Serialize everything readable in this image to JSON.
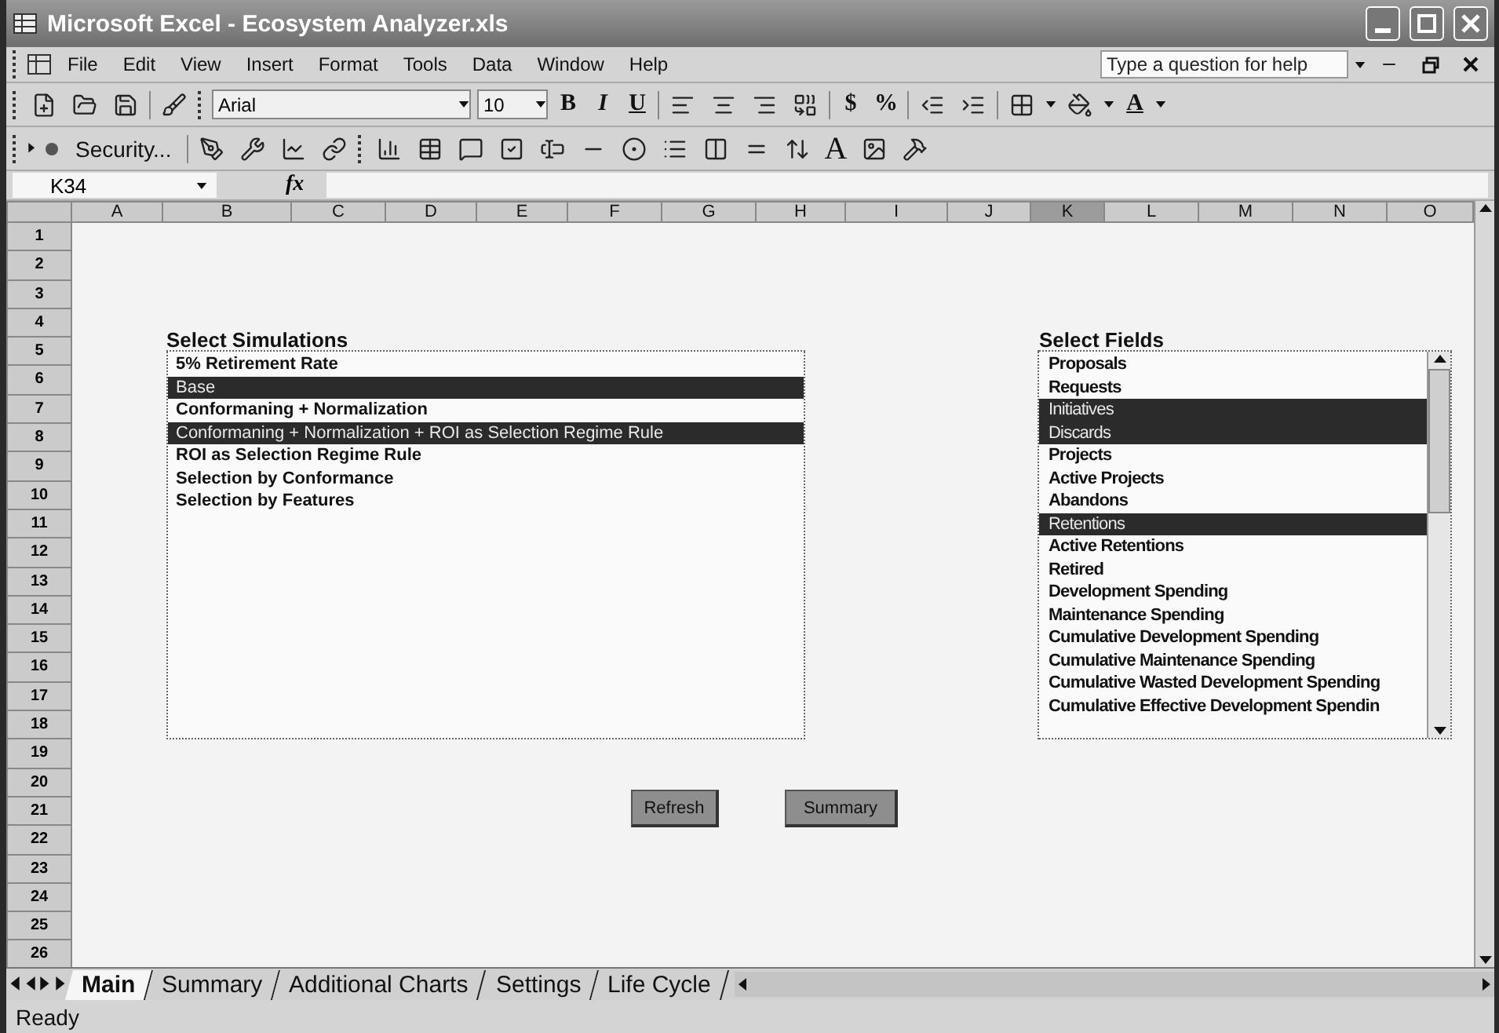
{
  "window": {
    "title": "Microsoft Excel - Ecosystem Analyzer.xls"
  },
  "menu": [
    "File",
    "Edit",
    "View",
    "Insert",
    "Format",
    "Tools",
    "Data",
    "Window",
    "Help"
  ],
  "help_box": {
    "placeholder": "Type a question for help"
  },
  "formatting_toolbar": {
    "font": "Arial",
    "size": "10",
    "bold": "B",
    "italic": "I",
    "underline": "U",
    "currency": "$",
    "percent": "%",
    "font_color": "A"
  },
  "forms_toolbar": {
    "security": "Security...",
    "label_glyph": "A"
  },
  "formula_bar": {
    "name_box": "K34",
    "fx": "fx"
  },
  "columns": [
    {
      "label": "A",
      "selected": false
    },
    {
      "label": "B",
      "selected": false
    },
    {
      "label": "C",
      "selected": false
    },
    {
      "label": "D",
      "selected": false
    },
    {
      "label": "E",
      "selected": false
    },
    {
      "label": "F",
      "selected": false
    },
    {
      "label": "G",
      "selected": false
    },
    {
      "label": "H",
      "selected": false
    },
    {
      "label": "I",
      "selected": false
    },
    {
      "label": "J",
      "selected": false
    },
    {
      "label": "K",
      "selected": true
    },
    {
      "label": "L",
      "selected": false
    },
    {
      "label": "M",
      "selected": false
    },
    {
      "label": "N",
      "selected": false
    },
    {
      "label": "O",
      "selected": false
    }
  ],
  "rows": [
    "1",
    "2",
    "3",
    "4",
    "5",
    "6",
    "7",
    "8",
    "9",
    "10",
    "11",
    "12",
    "13",
    "14",
    "15",
    "16",
    "17",
    "18",
    "19",
    "20",
    "21",
    "22",
    "23",
    "24",
    "25",
    "26"
  ],
  "simulations": {
    "heading": "Select Simulations",
    "items": [
      {
        "label": "5% Retirement Rate",
        "selected": false
      },
      {
        "label": "Base",
        "selected": true
      },
      {
        "label": "Conformaning + Normalization",
        "selected": false
      },
      {
        "label": "Conformaning + Normalization + ROI as Selection Regime Rule",
        "selected": true
      },
      {
        "label": "ROI as Selection Regime Rule",
        "selected": false
      },
      {
        "label": "Selection by Conformance",
        "selected": false
      },
      {
        "label": "Selection by Features",
        "selected": false
      }
    ]
  },
  "fields": {
    "heading": "Select Fields",
    "items": [
      {
        "label": "Proposals",
        "selected": false
      },
      {
        "label": "Requests",
        "selected": false
      },
      {
        "label": "Initiatives",
        "selected": true
      },
      {
        "label": "Discards",
        "selected": true
      },
      {
        "label": "Projects",
        "selected": false
      },
      {
        "label": "Active Projects",
        "selected": false
      },
      {
        "label": "Abandons",
        "selected": false
      },
      {
        "label": "Retentions",
        "selected": true
      },
      {
        "label": "Active Retentions",
        "selected": false
      },
      {
        "label": "Retired",
        "selected": false
      },
      {
        "label": "Development Spending",
        "selected": false
      },
      {
        "label": "Maintenance Spending",
        "selected": false
      },
      {
        "label": "Cumulative Development Spending",
        "selected": false
      },
      {
        "label": "Cumulative Maintenance Spending",
        "selected": false
      },
      {
        "label": "Cumulative Wasted Development Spending",
        "selected": false
      },
      {
        "label": "Cumulative Effective Development Spendin",
        "selected": false
      }
    ]
  },
  "buttons": [
    "Refresh",
    "Summary"
  ],
  "sheet_tabs": [
    {
      "label": "Main",
      "selected": true
    },
    {
      "label": "Summary",
      "selected": false
    },
    {
      "label": "Additional Charts",
      "selected": false
    },
    {
      "label": "Settings",
      "selected": false
    },
    {
      "label": "Life Cycle",
      "selected": false
    }
  ],
  "status_bar": {
    "text": "Ready"
  }
}
